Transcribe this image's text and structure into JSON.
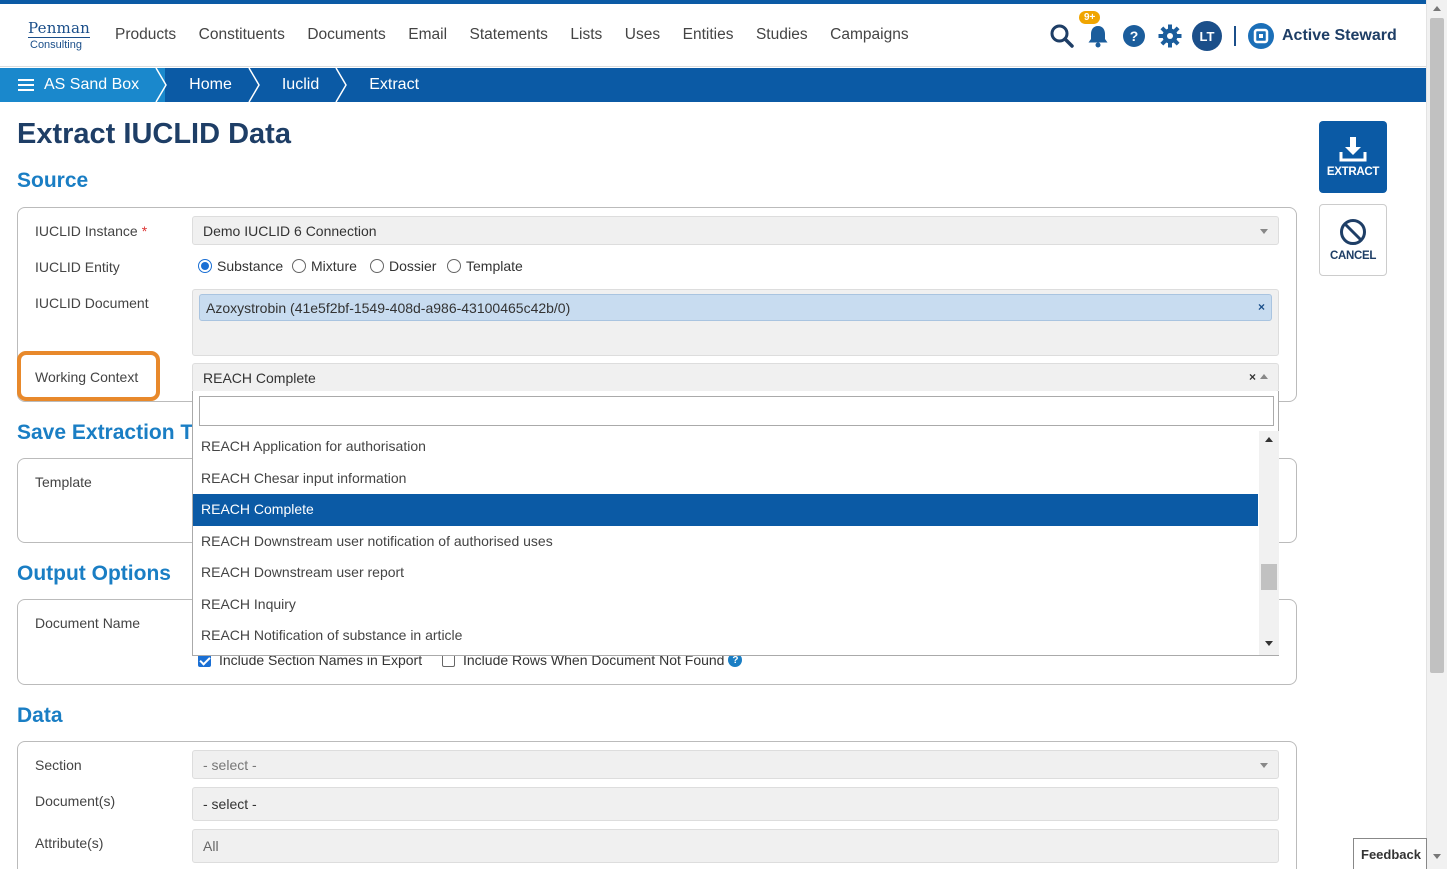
{
  "logo": {
    "line1": "Penman",
    "line2": "Consulting"
  },
  "nav": {
    "menu": [
      "Products",
      "Constituents",
      "Documents",
      "Email",
      "Statements",
      "Lists",
      "Uses",
      "Entities",
      "Studies",
      "Campaigns"
    ],
    "notification_badge": "9+",
    "avatar_initials": "LT",
    "brand_name": "Active Steward"
  },
  "breadcrumb": [
    "AS Sand Box",
    "Home",
    "Iuclid",
    "Extract"
  ],
  "page": {
    "title": "Extract IUCLID Data"
  },
  "source": {
    "title": "Source",
    "instance_label": "IUCLID Instance",
    "instance_required": "*",
    "instance_value": "Demo IUCLID 6 Connection",
    "entity_label": "IUCLID Entity",
    "entity_options": [
      "Substance",
      "Mixture",
      "Dossier",
      "Template"
    ],
    "entity_selected": "Substance",
    "document_label": "IUCLID Document",
    "document_tag": "Azoxystrobin (41e5f2bf-1549-408d-a986-43100465c42b/0)",
    "document_tag_remove": "×",
    "working_context_label": "Working Context",
    "working_context_value": "REACH Complete",
    "working_context_clear": "×"
  },
  "working_context_dropdown": {
    "search_value": "",
    "options": [
      "REACH Application for authorisation",
      "REACH Chesar input information",
      "REACH Complete",
      "REACH Downstream user notification of authorised uses",
      "REACH Downstream user report",
      "REACH Inquiry",
      "REACH Notification of substance in article"
    ],
    "selected": "REACH Complete"
  },
  "save_template": {
    "title": "Save Extraction Te",
    "template_label": "Template"
  },
  "output_options": {
    "title": "Output Options",
    "document_name_label": "Document Name",
    "include_section_names": "Include Section Names in Export",
    "include_section_names_checked": true,
    "include_rows_not_found": "Include Rows When Document Not Found",
    "include_rows_not_found_checked": false,
    "help": "?"
  },
  "data": {
    "title": "Data",
    "section_label": "Section",
    "section_value": "- select -",
    "documents_label": "Document(s)",
    "documents_value": "- select -",
    "attributes_label": "Attribute(s)",
    "attributes_value": "All"
  },
  "actions": {
    "extract_label": "EXTRACT",
    "cancel_label": "CANCEL"
  },
  "feedback_label": "Feedback",
  "colors": {
    "primary": "#0b5aa5",
    "accent": "#1a7ec4",
    "highlight": "#e8892b",
    "heading": "#1e3e66"
  }
}
